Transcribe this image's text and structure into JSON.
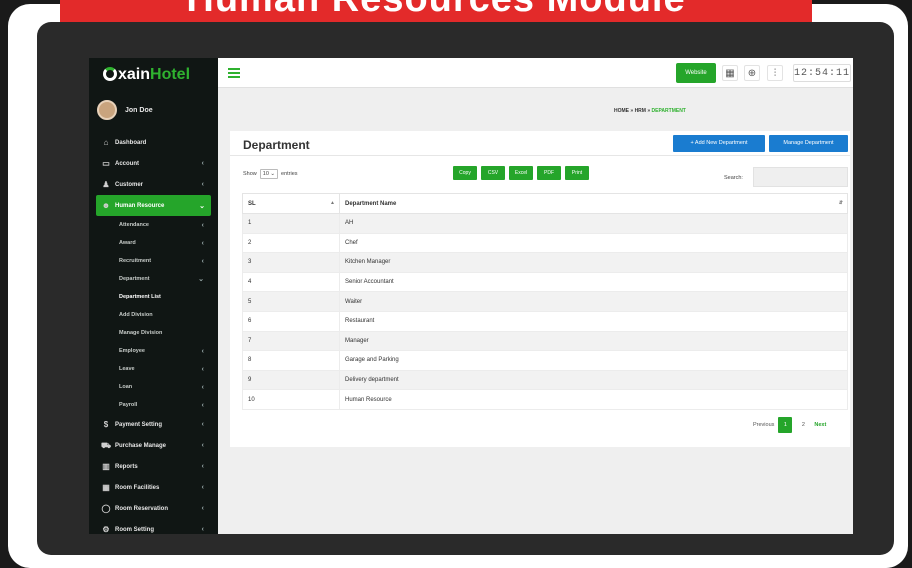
{
  "banner": {
    "title": "Human Resources Module"
  },
  "app": {
    "logo_prefix": "xain",
    "logo_suffix": "Hotel"
  },
  "user": {
    "name": "Jon Doe"
  },
  "nav": {
    "dashboard": "Dashboard",
    "account": "Account",
    "customer": "Customer",
    "human_resource": "Human Resource",
    "sub": {
      "attendance": "Attendance",
      "award": "Award",
      "recruitment": "Recruitment",
      "department": "Department",
      "department_list": "Department List",
      "add_division": "Add Division",
      "manage_division": "Manage Division",
      "employee": "Employee",
      "leave": "Leave",
      "loan": "Loan",
      "payroll": "Payroll"
    },
    "payment_setting": "Payment Setting",
    "purchase_manage": "Purchase Manage",
    "reports": "Reports",
    "room_facilities": "Room Facilities",
    "room_reservation": "Room Reservation",
    "room_setting": "Room Setting"
  },
  "header": {
    "website_label": "Website",
    "clock": "12:54:11"
  },
  "breadcrumb": {
    "home": "HOME",
    "hrm": "HRM",
    "current": "DEPARTMENT",
    "separator": "»"
  },
  "panel": {
    "title": "Department",
    "add_button": "+ Add New Department",
    "manage_button": "Manage Department",
    "show_label": "Show",
    "entries_value": "10",
    "entries_label": "entries",
    "search_label": "Search:",
    "export_buttons": [
      "Copy",
      "CSV",
      "Excel",
      "PDF",
      "Print"
    ]
  },
  "table": {
    "columns": [
      "SL",
      "Department Name"
    ],
    "rows": [
      [
        "1",
        "AH"
      ],
      [
        "2",
        "Chef"
      ],
      [
        "3",
        "Kitchen Manager"
      ],
      [
        "4",
        "Senior Accountant"
      ],
      [
        "5",
        "Waiter"
      ],
      [
        "6",
        "Restaurant"
      ],
      [
        "7",
        "Manager"
      ],
      [
        "8",
        "Garage and Parking"
      ],
      [
        "9",
        "Delivery department"
      ],
      [
        "10",
        "Human Resource"
      ]
    ]
  },
  "pagination": {
    "previous": "Previous",
    "pages": [
      "1",
      "2"
    ],
    "next": "Next"
  },
  "colors": {
    "brand_green": "#25a52a",
    "banner_red": "#e32a2a",
    "button_blue": "#1a7cd0",
    "sidebar_bg": "#101614"
  }
}
